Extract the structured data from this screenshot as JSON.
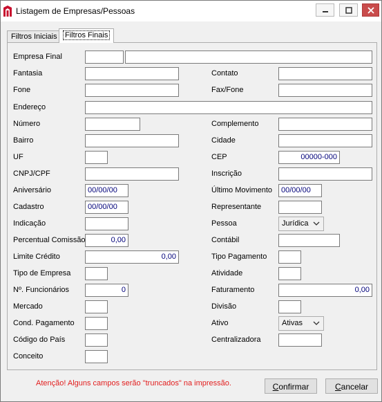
{
  "window": {
    "title": "Listagem de Empresas/Pessoas",
    "close_color": "#c94c4c"
  },
  "tabs": [
    {
      "label": "Filtros Iniciais",
      "active": false
    },
    {
      "label": "Filtros Finais",
      "active": true
    }
  ],
  "labels": {
    "empresa_final": "Empresa Final",
    "fantasia": "Fantasia",
    "contato": "Contato",
    "fone": "Fone",
    "fax_fone": "Fax/Fone",
    "endereco": "Endereço",
    "numero": "Número",
    "complemento": "Complemento",
    "bairro": "Bairro",
    "cidade": "Cidade",
    "uf": "UF",
    "cep": "CEP",
    "cnpj_cpf": "CNPJ/CPF",
    "inscricao": "Inscrição",
    "aniversario": "Aniversário",
    "ultimo_movimento": "Último Movimento",
    "cadastro": "Cadastro",
    "representante": "Representante",
    "indicacao": "Indicação",
    "pessoa": "Pessoa",
    "percentual_comissao": "Percentual Comissão",
    "contabil": "Contábil",
    "limite_credito": "Limite Crédito",
    "tipo_pagamento": "Tipo Pagamento",
    "tipo_empresa": "Tipo de Empresa",
    "atividade": "Atividade",
    "num_funcionarios": "Nº. Funcionários",
    "faturamento": "Faturamento",
    "mercado": "Mercado",
    "divisao": "Divisão",
    "cond_pagamento": "Cond. Pagamento",
    "ativo": "Ativo",
    "codigo_pais": "Código do País",
    "centralizadora": "Centralizadora",
    "conceito": "Conceito"
  },
  "values": {
    "cep": "00000-000",
    "aniversario": "00/00/00",
    "ultimo_movimento": "00/00/00",
    "cadastro": "00/00/00",
    "pessoa": "Jurídica",
    "percentual_comissao": "0,00",
    "limite_credito": "0,00",
    "num_funcionarios": "0",
    "faturamento": "0,00",
    "ativo": "Ativas"
  },
  "warning": "Atenção! Alguns campos serão \"truncados\" na impressão.",
  "buttons": {
    "confirmar_first": "C",
    "confirmar_rest": "onfirmar",
    "cancelar_first": "C",
    "cancelar_rest": "ancelar"
  }
}
